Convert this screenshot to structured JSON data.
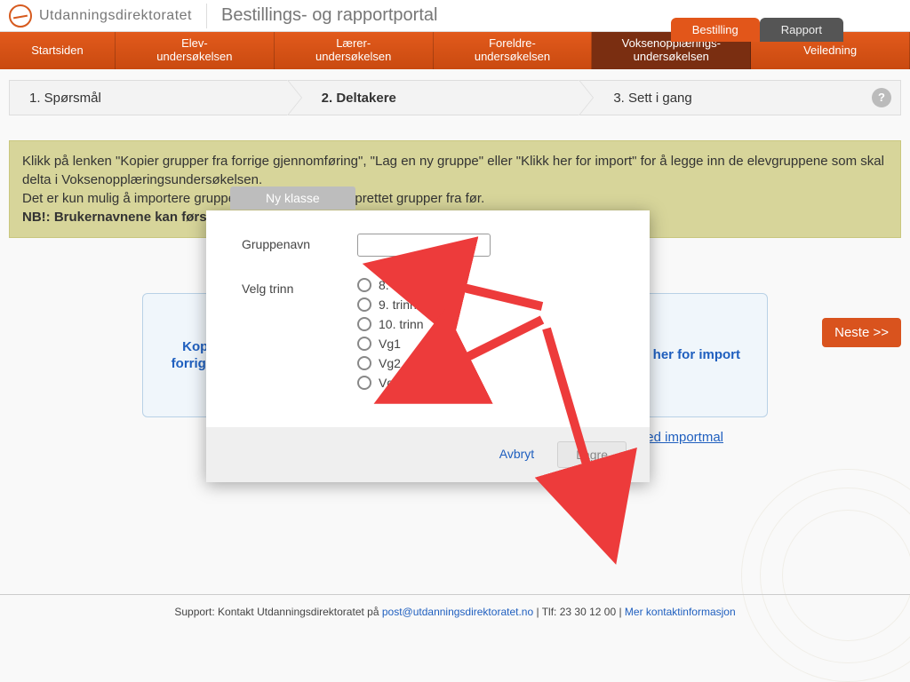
{
  "header": {
    "org": "Utdanningsdirektoratet",
    "portal": "Bestillings- og rapportportal"
  },
  "top_tabs": {
    "bestilling": "Bestilling",
    "rapport": "Rapport"
  },
  "nav": {
    "startsiden": "Startsiden",
    "elev": "Elev-\nundersøkelsen",
    "laerer": "Lærer-\nundersøkelsen",
    "foreldre": "Foreldre-\nundersøkelsen",
    "voksen": "Voksenopplærings-\nundersøkelsen",
    "veiledning": "Veiledning"
  },
  "wizard": {
    "step1": "1. Spørsmål",
    "step2": "2. Deltakere",
    "step3": "3. Sett i gang"
  },
  "info": {
    "line1": "Klikk på lenken \"Kopier grupper fra forrige gjennomføring\", \"Lag en ny gruppe\" eller \"Klikk her for import\" for å legge inn de elevgruppene som skal delta i Voksenopplæringsundersøkelsen.",
    "line2": "Det er kun mulig å importere grupper hvis du ikke har opprettet grupper fra før.",
    "nb": "NB!: Brukernavnene kan først skrives ut etter at undersøkelsen er satt i gang."
  },
  "buttons": {
    "next": "Neste >>"
  },
  "actions": {
    "copy": "Kopier grupper fra forrige gjennomføring",
    "import": "Klikk her for import"
  },
  "below_link": "Last ned importmal",
  "modal": {
    "title": "Ny klasse",
    "group_label": "Gruppenavn",
    "group_value": "",
    "trinn_label": "Velg trinn",
    "options": [
      "8. trinn",
      "9. trinn",
      "10. trinn",
      "Vg1",
      "Vg2",
      "Vg3"
    ],
    "cancel": "Avbryt",
    "save": "Lagre"
  },
  "footer": {
    "prefix": "Support: Kontakt Utdanningsdirektoratet på ",
    "email": "post@utdanningsdirektoratet.no",
    "phone_prefix": " | Tlf: ",
    "phone": "23 30 12 00",
    "sep": " | ",
    "more": "Mer kontaktinformasjon"
  }
}
